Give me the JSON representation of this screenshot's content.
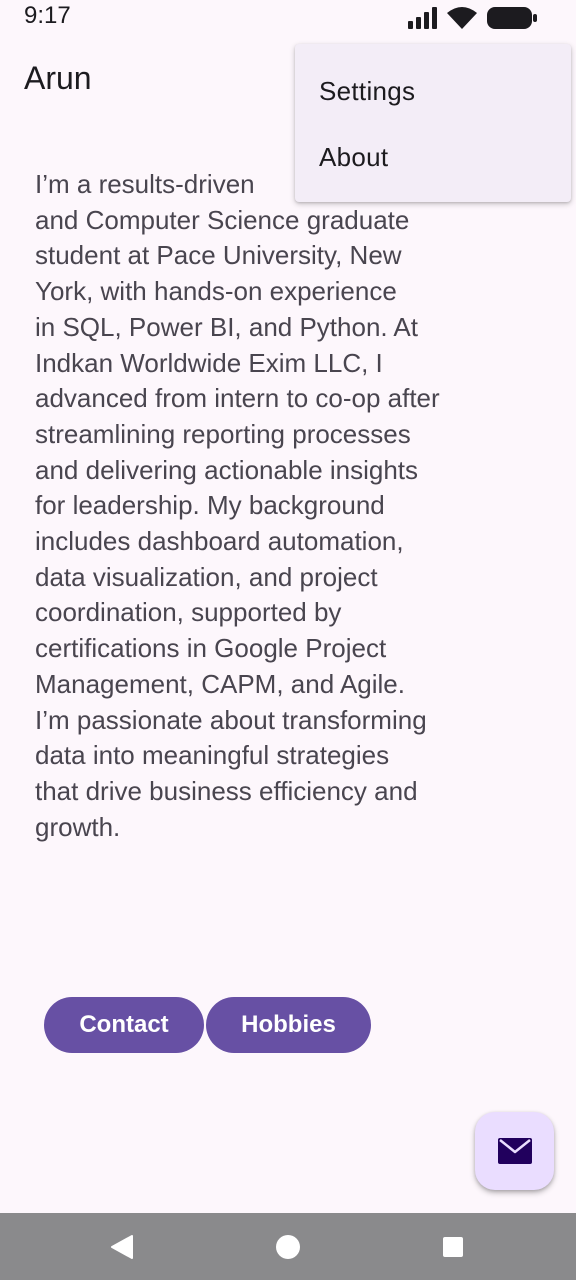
{
  "status_bar": {
    "time": "9:17",
    "icons": [
      "signal-icon",
      "wifi-icon",
      "battery-icon"
    ]
  },
  "app_bar": {
    "title": "Arun"
  },
  "overflow_menu": {
    "items": [
      {
        "label": "Settings"
      },
      {
        "label": "About"
      }
    ]
  },
  "main": {
    "bio": "I’m a results-driven \nand Computer Science graduate\nstudent at Pace University, New\nYork, with hands-on experience\nin SQL, Power BI, and Python. At\nIndkan Worldwide Exim LLC, I\nadvanced from intern to co-op after\nstreamlining reporting processes\nand delivering actionable insights\nfor leadership. My background\nincludes dashboard automation,\ndata visualization, and project\ncoordination, supported by\ncertifications in Google Project\nManagement, CAPM, and Agile.\nI’m passionate about transforming\ndata into meaningful strategies\nthat drive business efficiency and\ngrowth.",
    "buttons": {
      "contact": "Contact",
      "hobbies": "Hobbies"
    },
    "fab_icon": "mail-icon"
  },
  "nav_bar": {
    "icons": [
      "back-icon",
      "home-icon",
      "recents-icon"
    ]
  },
  "colors": {
    "background": "#fdf7fc",
    "primary": "#6750a4",
    "fab_container": "#eaddff",
    "menu_surface": "#f3edf7",
    "nav_bar": "#8a8a8c"
  }
}
